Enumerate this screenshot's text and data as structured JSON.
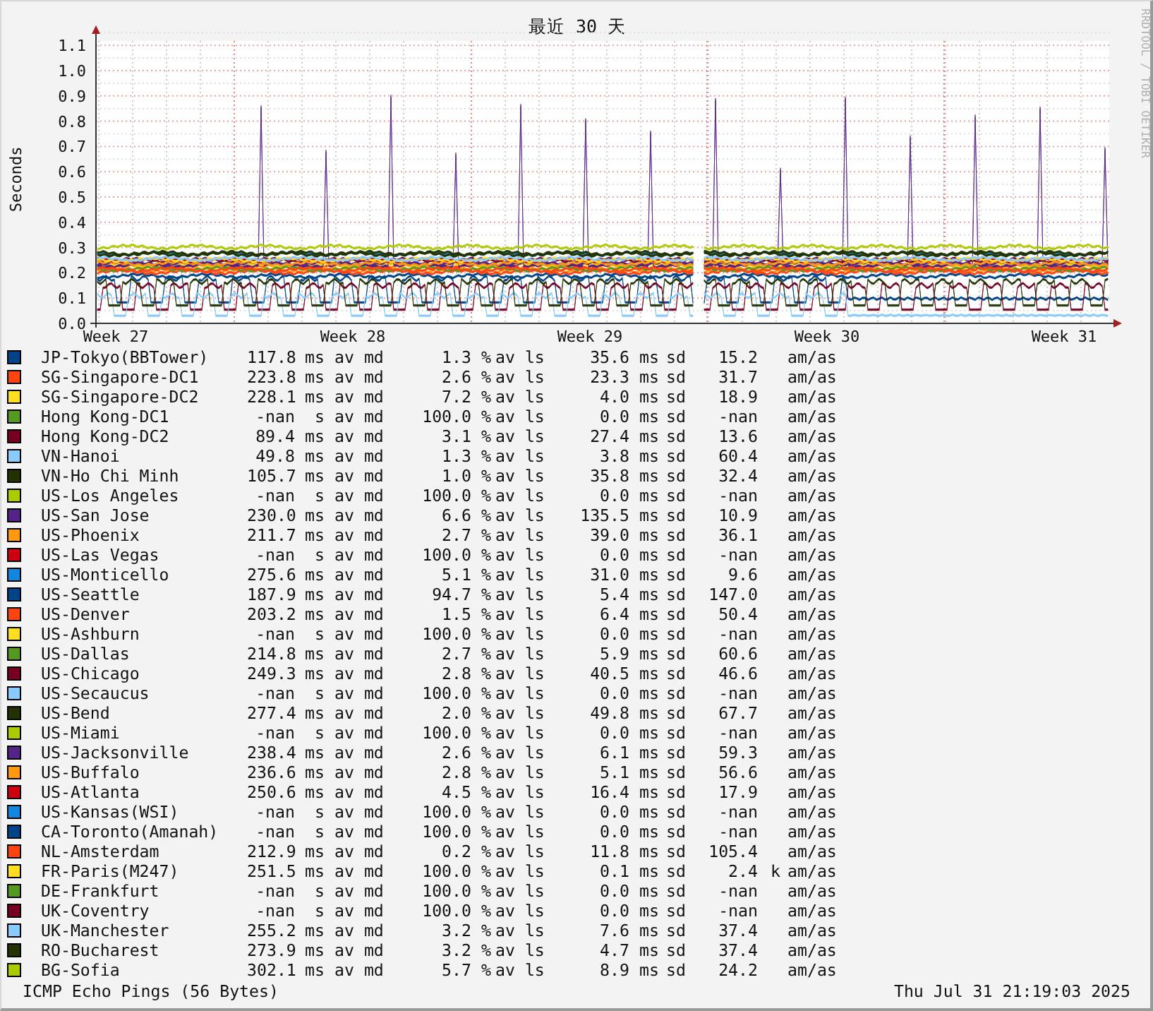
{
  "graph": {
    "title": "最近 30 天",
    "y_label": "Seconds",
    "credit": "RRDTOOL / TOBI OETIKER",
    "y_ticks": [
      "1.1",
      "1.0",
      "0.9",
      "0.8",
      "0.7",
      "0.6",
      "0.5",
      "0.4",
      "0.3",
      "0.2",
      "0.1",
      "0.0"
    ],
    "x_labels": [
      "Week 27",
      "Week 28",
      "Week 29",
      "Week 30",
      "Week 31"
    ]
  },
  "legend": [
    {
      "name": "JP-Tokyo(BBTower)",
      "color": "#004488",
      "median": "117.8",
      "median_unit": "ms",
      "median_label": "av md",
      "loss": "1.3",
      "loss_unit": "%",
      "loss_label": "av ls",
      "sd": "35.6",
      "sd_unit": "ms",
      "sd_label": "sd",
      "am": "15.2",
      "am_label": "am/as"
    },
    {
      "name": "SG-Singapore-DC1",
      "color": "#ff4411",
      "median": "223.8",
      "median_unit": "ms",
      "median_label": "av md",
      "loss": "2.6",
      "loss_unit": "%",
      "loss_label": "av ls",
      "sd": "23.3",
      "sd_unit": "ms",
      "sd_label": "sd",
      "am": "31.7",
      "am_label": "am/as"
    },
    {
      "name": "SG-Singapore-DC2",
      "color": "#ffdd22",
      "median": "228.1",
      "median_unit": "ms",
      "median_label": "av md",
      "loss": "7.2",
      "loss_unit": "%",
      "loss_label": "av ls",
      "sd": "4.0",
      "sd_unit": "ms",
      "sd_label": "sd",
      "am": "18.9",
      "am_label": "am/as"
    },
    {
      "name": "Hong Kong-DC1",
      "color": "#559922",
      "median": "-nan",
      "median_unit": "s",
      "median_label": "av md",
      "loss": "100.0",
      "loss_unit": "%",
      "loss_label": "av ls",
      "sd": "0.0",
      "sd_unit": "ms",
      "sd_label": "sd",
      "am": "-nan",
      "am_label": "am/as"
    },
    {
      "name": "Hong Kong-DC2",
      "color": "#770022",
      "median": "89.4",
      "median_unit": "ms",
      "median_label": "av md",
      "loss": "3.1",
      "loss_unit": "%",
      "loss_label": "av ls",
      "sd": "27.4",
      "sd_unit": "ms",
      "sd_label": "sd",
      "am": "13.6",
      "am_label": "am/as"
    },
    {
      "name": "VN-Hanoi",
      "color": "#88ccff",
      "median": "49.8",
      "median_unit": "ms",
      "median_label": "av md",
      "loss": "1.3",
      "loss_unit": "%",
      "loss_label": "av ls",
      "sd": "3.8",
      "sd_unit": "ms",
      "sd_label": "sd",
      "am": "60.4",
      "am_label": "am/as"
    },
    {
      "name": "VN-Ho Chi Minh",
      "color": "#223300",
      "median": "105.7",
      "median_unit": "ms",
      "median_label": "av md",
      "loss": "1.0",
      "loss_unit": "%",
      "loss_label": "av ls",
      "sd": "35.8",
      "sd_unit": "ms",
      "sd_label": "sd",
      "am": "32.4",
      "am_label": "am/as"
    },
    {
      "name": "US-Los Angeles",
      "color": "#aacc00",
      "median": "-nan",
      "median_unit": "s",
      "median_label": "av md",
      "loss": "100.0",
      "loss_unit": "%",
      "loss_label": "av ls",
      "sd": "0.0",
      "sd_unit": "ms",
      "sd_label": "sd",
      "am": "-nan",
      "am_label": "am/as"
    },
    {
      "name": "US-San Jose",
      "color": "#552288",
      "median": "230.0",
      "median_unit": "ms",
      "median_label": "av md",
      "loss": "6.6",
      "loss_unit": "%",
      "loss_label": "av ls",
      "sd": "135.5",
      "sd_unit": "ms",
      "sd_label": "sd",
      "am": "10.9",
      "am_label": "am/as"
    },
    {
      "name": "US-Phoenix",
      "color": "#ff9911",
      "median": "211.7",
      "median_unit": "ms",
      "median_label": "av md",
      "loss": "2.7",
      "loss_unit": "%",
      "loss_label": "av ls",
      "sd": "39.0",
      "sd_unit": "ms",
      "sd_label": "sd",
      "am": "36.1",
      "am_label": "am/as"
    },
    {
      "name": "US-Las Vegas",
      "color": "#cc0011",
      "median": "-nan",
      "median_unit": "s",
      "median_label": "av md",
      "loss": "100.0",
      "loss_unit": "%",
      "loss_label": "av ls",
      "sd": "0.0",
      "sd_unit": "ms",
      "sd_label": "sd",
      "am": "-nan",
      "am_label": "am/as"
    },
    {
      "name": "US-Monticello",
      "color": "#1188dd",
      "median": "275.6",
      "median_unit": "ms",
      "median_label": "av md",
      "loss": "5.1",
      "loss_unit": "%",
      "loss_label": "av ls",
      "sd": "31.0",
      "sd_unit": "ms",
      "sd_label": "sd",
      "am": "9.6",
      "am_label": "am/as"
    },
    {
      "name": "US-Seattle",
      "color": "#004488",
      "median": "187.9",
      "median_unit": "ms",
      "median_label": "av md",
      "loss": "94.7",
      "loss_unit": "%",
      "loss_label": "av ls",
      "sd": "5.4",
      "sd_unit": "ms",
      "sd_label": "sd",
      "am": "147.0",
      "am_label": "am/as"
    },
    {
      "name": "US-Denver",
      "color": "#ff4411",
      "median": "203.2",
      "median_unit": "ms",
      "median_label": "av md",
      "loss": "1.5",
      "loss_unit": "%",
      "loss_label": "av ls",
      "sd": "6.4",
      "sd_unit": "ms",
      "sd_label": "sd",
      "am": "50.4",
      "am_label": "am/as"
    },
    {
      "name": "US-Ashburn",
      "color": "#ffdd22",
      "median": "-nan",
      "median_unit": "s",
      "median_label": "av md",
      "loss": "100.0",
      "loss_unit": "%",
      "loss_label": "av ls",
      "sd": "0.0",
      "sd_unit": "ms",
      "sd_label": "sd",
      "am": "-nan",
      "am_label": "am/as"
    },
    {
      "name": "US-Dallas",
      "color": "#559922",
      "median": "214.8",
      "median_unit": "ms",
      "median_label": "av md",
      "loss": "2.7",
      "loss_unit": "%",
      "loss_label": "av ls",
      "sd": "5.9",
      "sd_unit": "ms",
      "sd_label": "sd",
      "am": "60.6",
      "am_label": "am/as"
    },
    {
      "name": "US-Chicago",
      "color": "#770022",
      "median": "249.3",
      "median_unit": "ms",
      "median_label": "av md",
      "loss": "2.8",
      "loss_unit": "%",
      "loss_label": "av ls",
      "sd": "40.5",
      "sd_unit": "ms",
      "sd_label": "sd",
      "am": "46.6",
      "am_label": "am/as"
    },
    {
      "name": "US-Secaucus",
      "color": "#88ccff",
      "median": "-nan",
      "median_unit": "s",
      "median_label": "av md",
      "loss": "100.0",
      "loss_unit": "%",
      "loss_label": "av ls",
      "sd": "0.0",
      "sd_unit": "ms",
      "sd_label": "sd",
      "am": "-nan",
      "am_label": "am/as"
    },
    {
      "name": "US-Bend",
      "color": "#223300",
      "median": "277.4",
      "median_unit": "ms",
      "median_label": "av md",
      "loss": "2.0",
      "loss_unit": "%",
      "loss_label": "av ls",
      "sd": "49.8",
      "sd_unit": "ms",
      "sd_label": "sd",
      "am": "67.7",
      "am_label": "am/as"
    },
    {
      "name": "US-Miami",
      "color": "#aacc00",
      "median": "-nan",
      "median_unit": "s",
      "median_label": "av md",
      "loss": "100.0",
      "loss_unit": "%",
      "loss_label": "av ls",
      "sd": "0.0",
      "sd_unit": "ms",
      "sd_label": "sd",
      "am": "-nan",
      "am_label": "am/as"
    },
    {
      "name": "US-Jacksonville",
      "color": "#552288",
      "median": "238.4",
      "median_unit": "ms",
      "median_label": "av md",
      "loss": "2.6",
      "loss_unit": "%",
      "loss_label": "av ls",
      "sd": "6.1",
      "sd_unit": "ms",
      "sd_label": "sd",
      "am": "59.3",
      "am_label": "am/as"
    },
    {
      "name": "US-Buffalo",
      "color": "#ff9911",
      "median": "236.6",
      "median_unit": "ms",
      "median_label": "av md",
      "loss": "2.8",
      "loss_unit": "%",
      "loss_label": "av ls",
      "sd": "5.1",
      "sd_unit": "ms",
      "sd_label": "sd",
      "am": "56.6",
      "am_label": "am/as"
    },
    {
      "name": "US-Atlanta",
      "color": "#cc0011",
      "median": "250.6",
      "median_unit": "ms",
      "median_label": "av md",
      "loss": "4.5",
      "loss_unit": "%",
      "loss_label": "av ls",
      "sd": "16.4",
      "sd_unit": "ms",
      "sd_label": "sd",
      "am": "17.9",
      "am_label": "am/as"
    },
    {
      "name": "US-Kansas(WSI)",
      "color": "#1188dd",
      "median": "-nan",
      "median_unit": "s",
      "median_label": "av md",
      "loss": "100.0",
      "loss_unit": "%",
      "loss_label": "av ls",
      "sd": "0.0",
      "sd_unit": "ms",
      "sd_label": "sd",
      "am": "-nan",
      "am_label": "am/as"
    },
    {
      "name": "CA-Toronto(Amanah)",
      "color": "#004488",
      "median": "-nan",
      "median_unit": "s",
      "median_label": "av md",
      "loss": "100.0",
      "loss_unit": "%",
      "loss_label": "av ls",
      "sd": "0.0",
      "sd_unit": "ms",
      "sd_label": "sd",
      "am": "-nan",
      "am_label": "am/as"
    },
    {
      "name": "NL-Amsterdam",
      "color": "#ff4411",
      "median": "212.9",
      "median_unit": "ms",
      "median_label": "av md",
      "loss": "0.2",
      "loss_unit": "%",
      "loss_label": "av ls",
      "sd": "11.8",
      "sd_unit": "ms",
      "sd_label": "sd",
      "am": "105.4",
      "am_label": "am/as"
    },
    {
      "name": "FR-Paris(M247)",
      "color": "#ffdd22",
      "median": "251.5",
      "median_unit": "ms",
      "median_label": "av md",
      "loss": "100.0",
      "loss_unit": "%",
      "loss_label": "av ls",
      "sd": "0.1",
      "sd_unit": "ms",
      "sd_label": "sd",
      "am": "2.4",
      "am_prefix": "k",
      "am_label": "am/as"
    },
    {
      "name": "DE-Frankfurt",
      "color": "#559922",
      "median": "-nan",
      "median_unit": "s",
      "median_label": "av md",
      "loss": "100.0",
      "loss_unit": "%",
      "loss_label": "av ls",
      "sd": "0.0",
      "sd_unit": "ms",
      "sd_label": "sd",
      "am": "-nan",
      "am_label": "am/as"
    },
    {
      "name": "UK-Coventry",
      "color": "#770022",
      "median": "-nan",
      "median_unit": "s",
      "median_label": "av md",
      "loss": "100.0",
      "loss_unit": "%",
      "loss_label": "av ls",
      "sd": "0.0",
      "sd_unit": "ms",
      "sd_label": "sd",
      "am": "-nan",
      "am_label": "am/as"
    },
    {
      "name": "UK-Manchester",
      "color": "#88ccff",
      "median": "255.2",
      "median_unit": "ms",
      "median_label": "av md",
      "loss": "3.2",
      "loss_unit": "%",
      "loss_label": "av ls",
      "sd": "7.6",
      "sd_unit": "ms",
      "sd_label": "sd",
      "am": "37.4",
      "am_label": "am/as"
    },
    {
      "name": "RO-Bucharest",
      "color": "#223300",
      "median": "273.9",
      "median_unit": "ms",
      "median_label": "av md",
      "loss": "3.2",
      "loss_unit": "%",
      "loss_label": "av ls",
      "sd": "4.7",
      "sd_unit": "ms",
      "sd_label": "sd",
      "am": "37.4",
      "am_label": "am/as"
    },
    {
      "name": "BG-Sofia",
      "color": "#aacc00",
      "median": "302.1",
      "median_unit": "ms",
      "median_label": "av md",
      "loss": "5.7",
      "loss_unit": "%",
      "loss_label": "av ls",
      "sd": "8.9",
      "sd_unit": "ms",
      "sd_label": "sd",
      "am": "24.2",
      "am_label": "am/as"
    }
  ],
  "footer": {
    "probe": "ICMP Echo Pings (56 Bytes)",
    "timestamp": "Thu Jul 31 21:19:03 2025"
  }
}
